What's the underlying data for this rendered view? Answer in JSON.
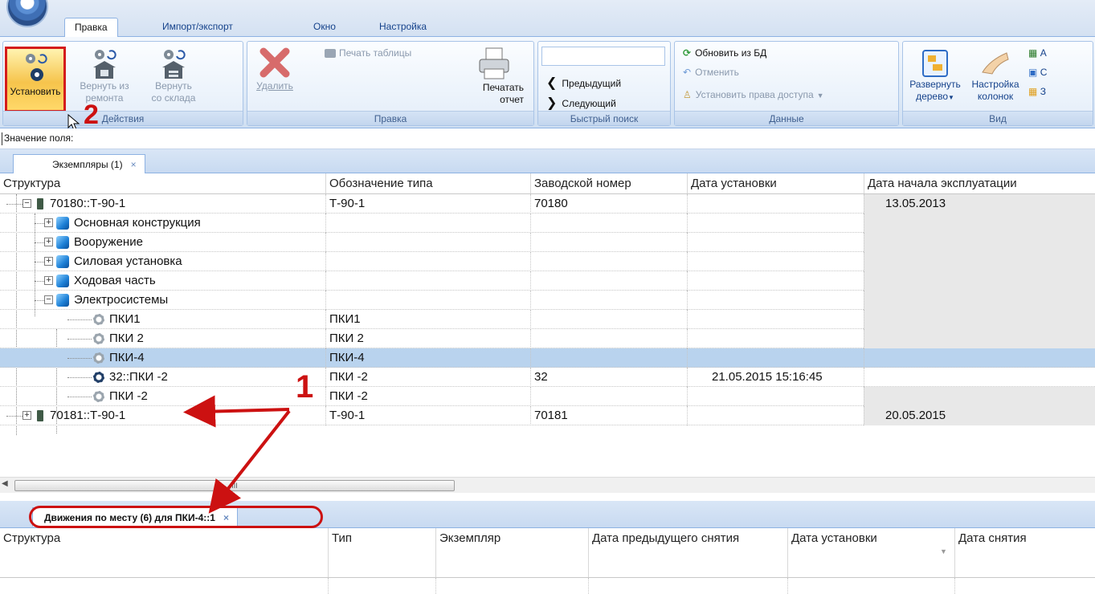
{
  "ribbon_tabs": [
    "Правка",
    "Импорт/экспорт",
    "Окно",
    "Настройка"
  ],
  "groups": {
    "actions": {
      "label": "Действия",
      "install": "Установить",
      "return_repair_1": "Вернуть из",
      "return_repair_2": "ремонта",
      "return_stock_1": "Вернуть",
      "return_stock_2": "со склада"
    },
    "edit": {
      "label": "Правка",
      "delete": "Удалить",
      "print_table": "Печать таблицы",
      "print_report_1": "Печатать",
      "print_report_2": "отчет"
    },
    "quick_search": {
      "label": "Быстрый поиск",
      "input_value": "",
      "prev": "Предыдущий",
      "next": "Следующий"
    },
    "data": {
      "label": "Данные",
      "refresh": "Обновить из БД",
      "cancel": "Отменить",
      "access": "Установить права доступа"
    },
    "view": {
      "label": "Вид",
      "expand_1": "Развернуть",
      "expand_2": "дерево",
      "columns_1": "Настройка",
      "columns_2": "колонок",
      "c1": "А",
      "c2": "С",
      "c3": "З"
    }
  },
  "field_value_label": "Значение поля:",
  "top_tab": {
    "label": "Экземпляры (1)",
    "close": "×"
  },
  "top_grid": {
    "columns": [
      "Структура",
      "Обозначение типа",
      "Заводской номер",
      "Дата установки",
      "Дата начала эксплуатации"
    ],
    "rows": [
      {
        "structure": "70180::Т-90-1",
        "type": "Т-90-1",
        "serial": "70180",
        "install": "",
        "start": "13.05.2013"
      },
      {
        "structure": "Основная конструкция",
        "type": "",
        "serial": "",
        "install": "",
        "start": ""
      },
      {
        "structure": "Вооружение",
        "type": "",
        "serial": "",
        "install": "",
        "start": ""
      },
      {
        "structure": "Силовая установка",
        "type": "",
        "serial": "",
        "install": "",
        "start": ""
      },
      {
        "structure": "Ходовая часть",
        "type": "",
        "serial": "",
        "install": "",
        "start": ""
      },
      {
        "structure": "Электросистемы",
        "type": "",
        "serial": "",
        "install": "",
        "start": ""
      },
      {
        "structure": "ПКИ1",
        "type": "ПКИ1",
        "serial": "",
        "install": "",
        "start": ""
      },
      {
        "structure": "ПКИ 2",
        "type": "ПКИ 2",
        "serial": "",
        "install": "",
        "start": ""
      },
      {
        "structure": "ПКИ-4",
        "type": "ПКИ-4",
        "serial": "",
        "install": "",
        "start": ""
      },
      {
        "structure": "32::ПКИ -2",
        "type": "ПКИ -2",
        "serial": "32",
        "install": "21.05.2015 15:16:45",
        "start": ""
      },
      {
        "structure": "ПКИ -2",
        "type": "ПКИ -2",
        "serial": "",
        "install": "",
        "start": ""
      },
      {
        "structure": "70181::Т-90-1",
        "type": "Т-90-1",
        "serial": "70181",
        "install": "",
        "start": "20.05.2015"
      }
    ]
  },
  "scroll_mark": "III",
  "bottom_tab": {
    "label": "Движения по месту (6) для ПКИ-4::1",
    "close": "×"
  },
  "bottom_grid": {
    "columns": [
      "Структура",
      "Тип",
      "Экземпляр",
      "Дата предыдущего снятия",
      "Дата установки",
      "Дата снятия"
    ]
  },
  "annotations": {
    "one": "1",
    "two": "2"
  },
  "colors": {
    "annotation": "#cc1111",
    "selected_row": "#b9d3ee",
    "ribbon_text": "#15428b"
  }
}
